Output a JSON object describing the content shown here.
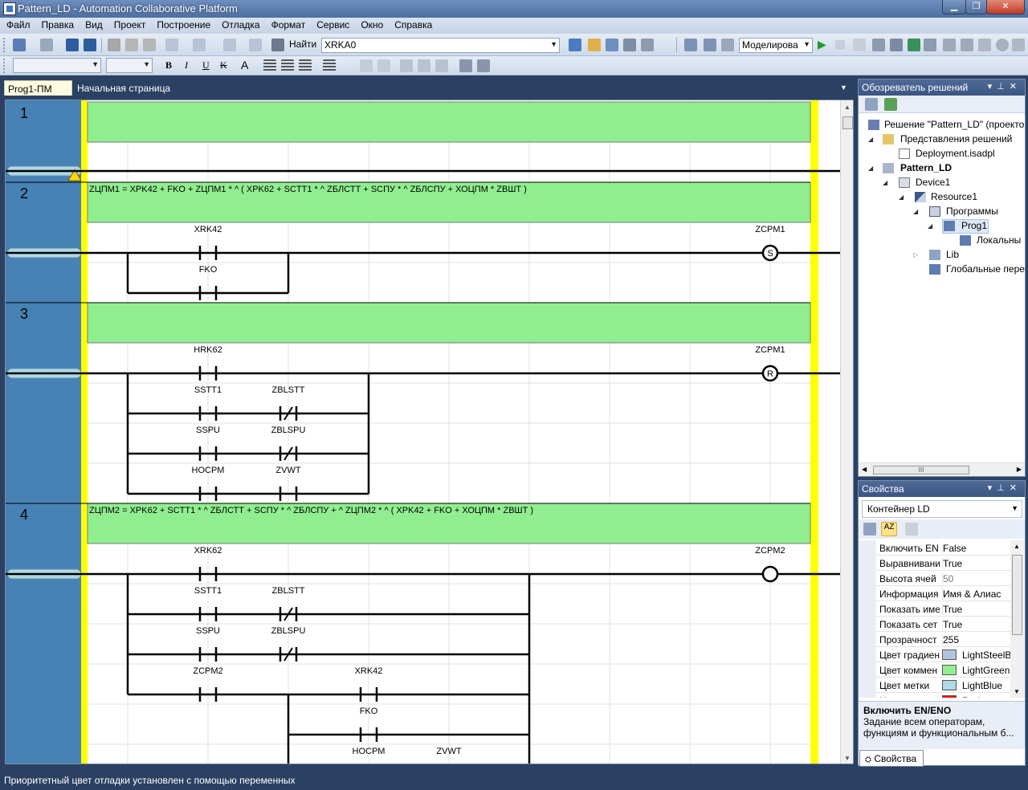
{
  "window": {
    "title": "Pattern_LD - Automation Collaborative Platform"
  },
  "menu": [
    "Файл",
    "Правка",
    "Вид",
    "Проект",
    "Построение",
    "Отладка",
    "Формат",
    "Сервис",
    "Окно",
    "Справка"
  ],
  "toolbar": {
    "find_label": "Найти",
    "find_value": "XRKA0",
    "mode_value": "Моделирова"
  },
  "tabs": {
    "active": "Prog1-ПМ",
    "other": "Начальная страница"
  },
  "ladder": {
    "rungs": [
      {
        "number": "1",
        "comment": ""
      },
      {
        "number": "2",
        "comment": "ZЦПМ1  =  XPK42 + FKO + ZЦПМ1 * ^  (  XPK62 + SCTT1 * ^  ZБЛСТТ + SCПУ * ^  ZБЛСПУ + ХОЦПМ * ZВШТ )"
      },
      {
        "number": "3",
        "comment": ""
      },
      {
        "number": "4",
        "comment": "ZЦПМ2  =  XPK62 + SCTT1 * ^  ZБЛСТТ + SCПУ * ^  ZБЛСПУ + ^  ZЦПМ2 * ^  (  XPK42 + FKO + ХОЦПМ * ZВШТ )"
      }
    ],
    "labels": {
      "r2_xrk42": "XRK42",
      "r2_fko": "FKO",
      "r2_coil": "ZCPM1",
      "r2_coil_type": "S",
      "r3_hrk62": "HRK62",
      "r3_sstt1": "SSTT1",
      "r3_zblstt": "ZBLSTT",
      "r3_sspu": "SSPU",
      "r3_zblspu": "ZBLSPU",
      "r3_hocpm": "HOCPM",
      "r3_zvwt": "ZVWT",
      "r3_coil": "ZCPM1",
      "r3_coil_type": "R",
      "r4_xrk62": "XRK62",
      "r4_sstt1": "SSTT1",
      "r4_zblstt": "ZBLSTT",
      "r4_sspu": "SSPU",
      "r4_zblspu": "ZBLSPU",
      "r4_zcpm2": "ZCPM2",
      "r4_xrk42": "XRK42",
      "r4_fko": "FKO",
      "r4_hocpm": "HOCPM",
      "r4_zvwt": "ZVWT",
      "r4_coil": "ZCPM2"
    }
  },
  "solution_explorer": {
    "title": "Обозреватель решений",
    "items": [
      "Решение \"Pattern_LD\"  (проекто",
      "Представления решений",
      "Deployment.isadpl",
      "Pattern_LD",
      "Device1",
      "Resource1",
      "Программы",
      "Prog1",
      "Локальны",
      "Lib",
      "Глобальные пере"
    ]
  },
  "properties": {
    "title": "Свойства",
    "object": "Контейнер LD",
    "rows": [
      {
        "key": "Включить EN",
        "value": "False"
      },
      {
        "key": "Выравнивани",
        "value": "True"
      },
      {
        "key": "Высота ячей",
        "value": "50"
      },
      {
        "key": "Информация",
        "value": "Имя & Алиас"
      },
      {
        "key": "Показать име",
        "value": "True"
      },
      {
        "key": "Показать сет",
        "value": "True"
      },
      {
        "key": "Прозрачност",
        "value": "255"
      },
      {
        "key": "Цвет градиен",
        "value": "LightSteelB",
        "color": "#b0c4de"
      },
      {
        "key": "Цвет коммен",
        "value": "LightGreen",
        "color": "#90ee90"
      },
      {
        "key": "Цвет метки",
        "value": "LightBlue",
        "color": "#add8e6"
      },
      {
        "key": "Цвет переме",
        "value": "Red",
        "color": "#ff0000"
      }
    ],
    "desc_title": "Включить EN/ENO",
    "desc_text": "Задание всем операторам, функциям и функциональным б...",
    "tab_label": "Свойства"
  },
  "status": {
    "text": "Приоритетный цвет отладки установлен с помощью переменных"
  }
}
